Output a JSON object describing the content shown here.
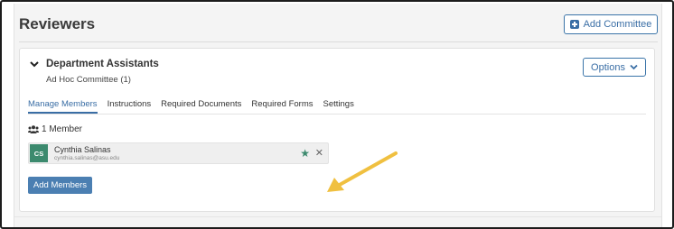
{
  "header": {
    "title": "Reviewers",
    "add_committee_label": "Add Committee"
  },
  "committee": {
    "title": "Department Assistants",
    "subtitle": "Ad Hoc Committee (1)",
    "options_label": "Options"
  },
  "tabs": [
    {
      "label": "Manage Members",
      "active": true
    },
    {
      "label": "Instructions",
      "active": false
    },
    {
      "label": "Required Documents",
      "active": false
    },
    {
      "label": "Required Forms",
      "active": false
    },
    {
      "label": "Settings",
      "active": false
    }
  ],
  "members": {
    "count_label": "1 Member",
    "list": [
      {
        "initials": "CS",
        "name": "Cynthia Salinas",
        "email": "cynthia.salinas@asu.edu"
      }
    ],
    "add_button_label": "Add Members"
  },
  "colors": {
    "accent": "#3a6ea5",
    "avatar": "#3c8a6e",
    "arrow": "#f0c040"
  },
  "icons": {
    "add": "plus-square-icon",
    "chevron": "chevron-down-icon",
    "users": "users-icon",
    "star": "star-icon",
    "remove": "close-icon"
  }
}
